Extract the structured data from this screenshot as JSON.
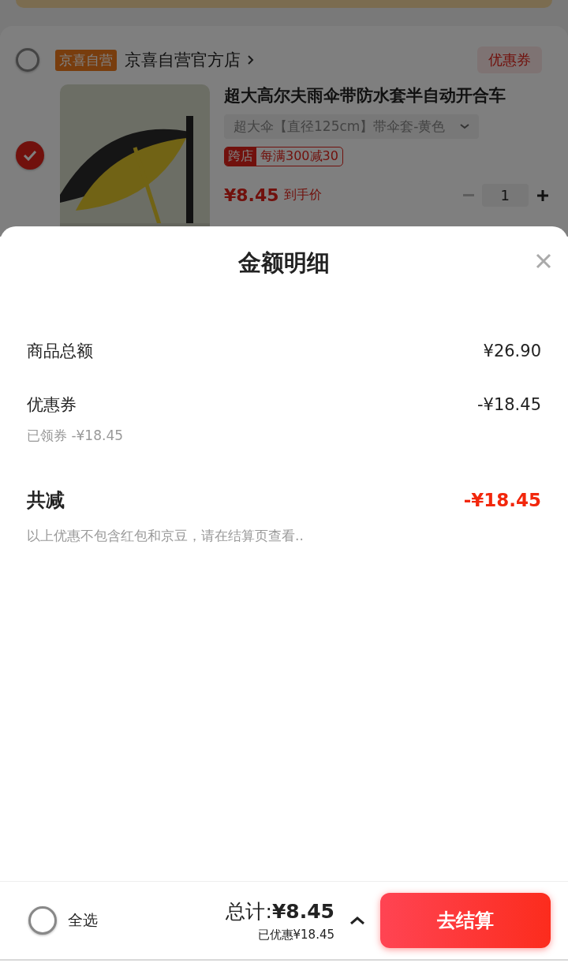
{
  "cart": {
    "store": {
      "selected": false,
      "tag": "京喜自营",
      "name": "京喜自营官方店",
      "coupon_button": "优惠券"
    },
    "product": {
      "selected": true,
      "title": "超大高尔夫雨伞带防水套半自动开合车",
      "spec": "超大伞【直径125cm】带伞套-黄色",
      "promo": {
        "tag": "跨店",
        "text": "每满300减30"
      },
      "price": "¥8.45",
      "price_note": "到手价",
      "quantity": "1"
    }
  },
  "sheet": {
    "title": "金额明细",
    "rows": [
      {
        "kind": "line",
        "label": "商品总额",
        "value": "¥26.90"
      },
      {
        "kind": "line",
        "label": "优惠券",
        "value": "-¥18.45",
        "sub": "已领券 -¥18.45"
      },
      {
        "kind": "total",
        "label": "共减",
        "value": "-¥18.45",
        "note": "以上优惠不包含红包和京豆，请在结算页查看.."
      }
    ]
  },
  "bottom_bar": {
    "select_all": {
      "label": "全选",
      "selected": false
    },
    "total": "总计:**¥8.45**",
    "saved": "已优惠¥18.45",
    "checkout": "去结算"
  }
}
